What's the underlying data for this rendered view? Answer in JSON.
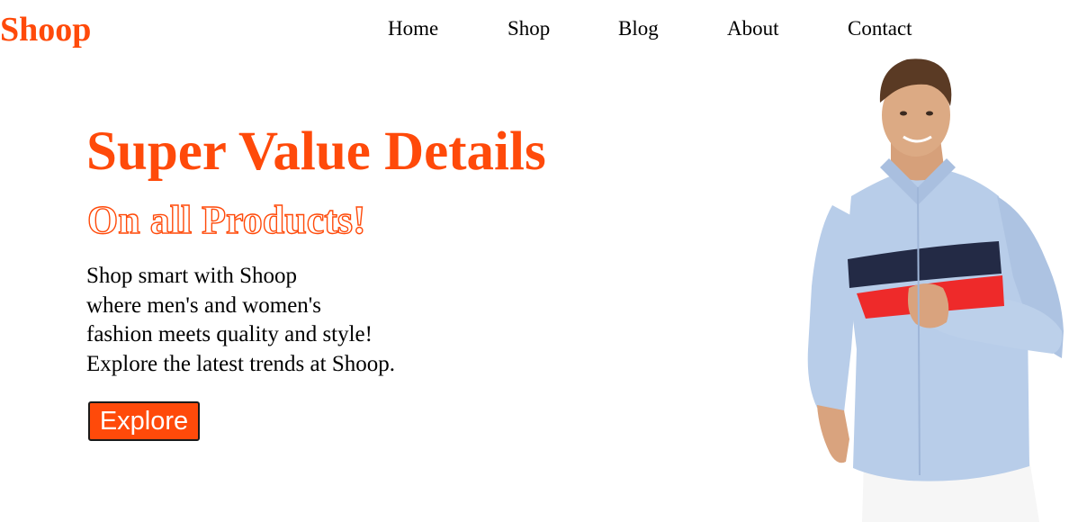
{
  "header": {
    "logo": "Shoop",
    "nav": [
      "Home",
      "Shop",
      "Blog",
      "About",
      "Contact"
    ]
  },
  "hero": {
    "title": "Super Value Details",
    "subtitle": "On all Products!",
    "description": [
      "Shop smart with Shoop",
      "where men's and women's",
      "fashion meets quality and style!",
      "Explore the latest trends at Shoop."
    ],
    "button_label": "Explore"
  },
  "colors": {
    "brand": "#ff4a0a",
    "shirt": "#b8cde9",
    "stripe_navy": "#232a45",
    "stripe_red": "#ee2a2a"
  }
}
